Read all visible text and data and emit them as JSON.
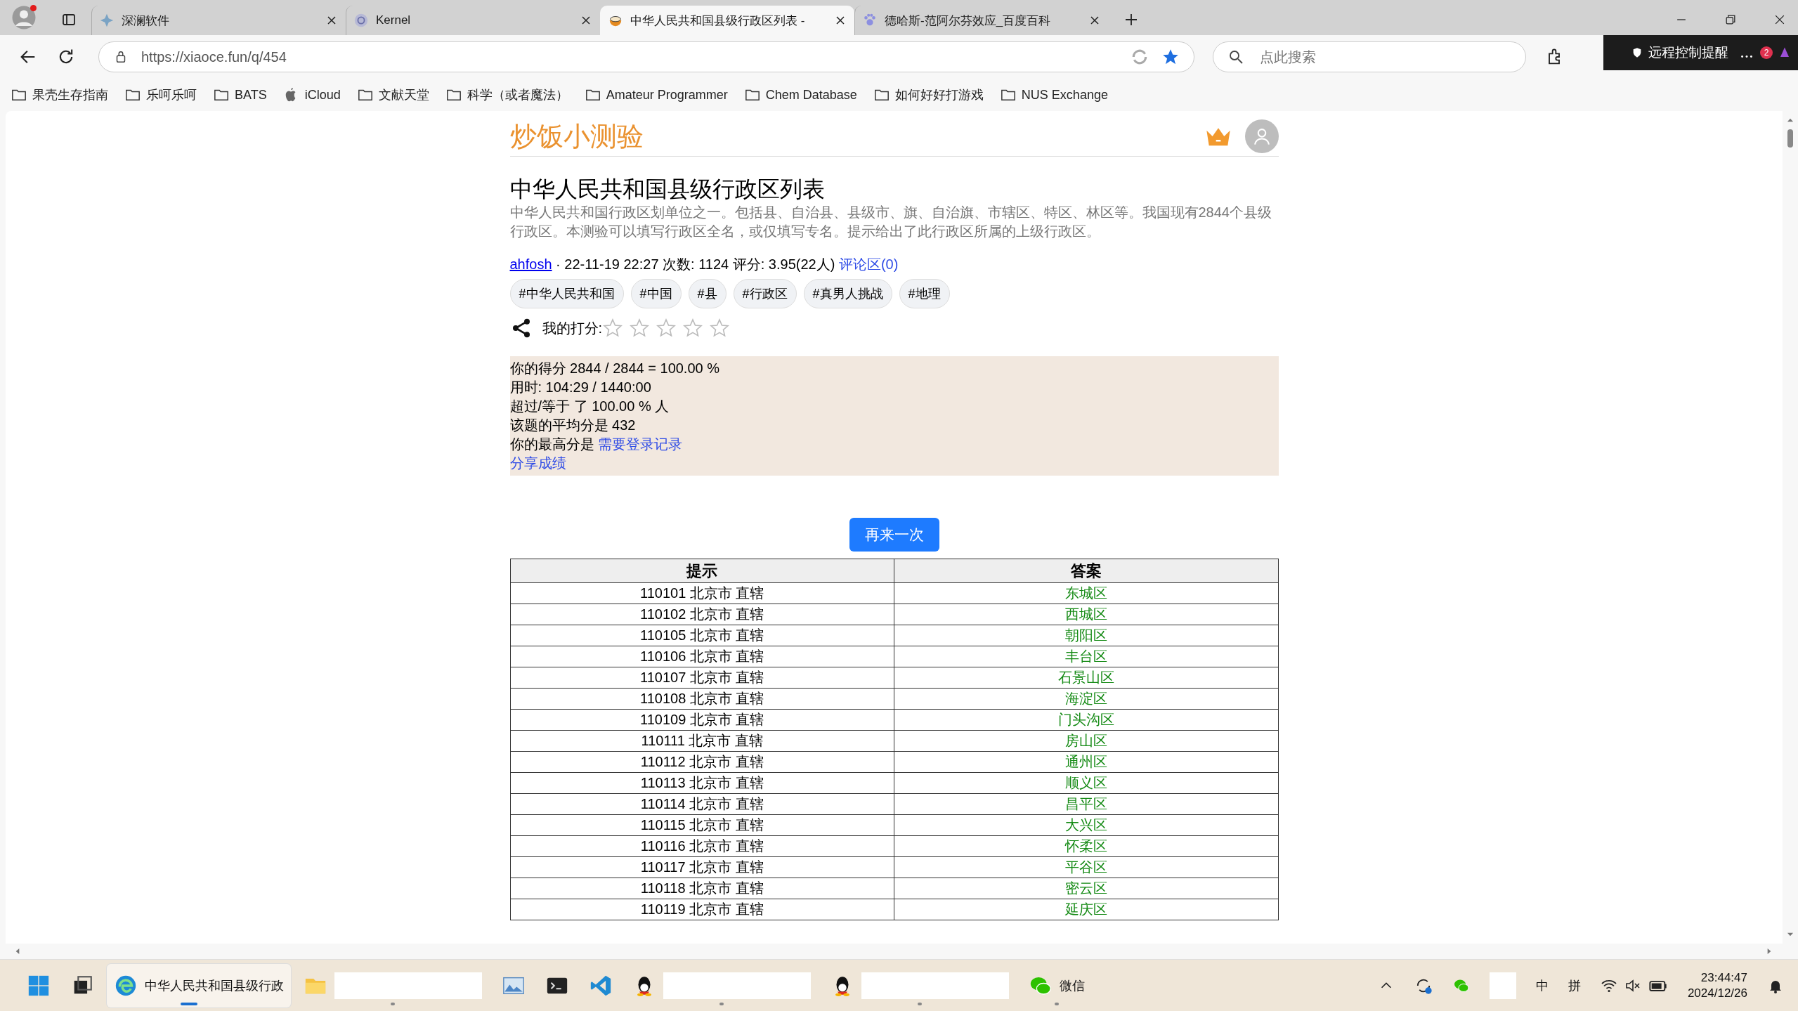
{
  "browser": {
    "tabs": [
      {
        "title": "深澜软件",
        "kind": "compass",
        "selected": false
      },
      {
        "title": "Kernel",
        "kind": "kernel",
        "selected": false
      },
      {
        "title": "中华人民共和国县级行政区列表 -",
        "kind": "bowl",
        "selected": true
      },
      {
        "title": "德哈斯-范阿尔芬效应_百度百科",
        "kind": "paw",
        "selected": false
      }
    ],
    "address": "https://xiaoce.fun/q/454",
    "search_placeholder": "点此搜索",
    "notification": {
      "text": "远程控制提醒",
      "badge": "2"
    },
    "bookmarks": [
      {
        "kind": "folder",
        "label": "果壳生存指南"
      },
      {
        "kind": "folder",
        "label": "乐呵乐呵"
      },
      {
        "kind": "folder",
        "label": "BATS"
      },
      {
        "kind": "apple",
        "label": "iCloud"
      },
      {
        "kind": "folder",
        "label": "文献天堂"
      },
      {
        "kind": "folder",
        "label": "科学（或者魔法）"
      },
      {
        "kind": "folder",
        "label": "Amateur Programmer"
      },
      {
        "kind": "folder",
        "label": "Chem Database"
      },
      {
        "kind": "folder",
        "label": "如何好好打游戏"
      },
      {
        "kind": "folder",
        "label": "NUS Exchange"
      }
    ]
  },
  "page": {
    "site_title": "炒饭小测验",
    "quiz_title": "中华人民共和国县级行政区列表",
    "description": "中华人民共和国行政区划单位之一。包括县、自治县、县级市、旗、自治旗、市辖区、特区、林区等。我国现有2844个县级行政区。本测验可以填写行政区全名，或仅填写专名。提示给出了此行政区所属的上级行政区。",
    "author": "ahfosh",
    "meta": "· 22-11-19 22:27 次数: 1124 评分: 3.95(22人)",
    "comments_link": "评论区(0)",
    "tags": [
      "#中华人民共和国",
      "#中国",
      "#县",
      "#行政区",
      "#真男人挑战",
      "#地理"
    ],
    "my_rating_label": "我的打分:",
    "stars": 0,
    "result_lines": [
      "你的得分 2844 / 2844 = 100.00 %",
      "用时: 104:29 / 1440:00",
      "超过/等于 了 100.00 % 人",
      "该题的平均分是 432"
    ],
    "best_score_label": "你的最高分是",
    "login_link": "需要登录记录",
    "share_link": "分享成绩",
    "retry_button": "再来一次",
    "table": {
      "columns": [
        "提示",
        "答案"
      ],
      "rows": [
        {
          "hint": "110101 北京市 直辖",
          "answer": "东城区"
        },
        {
          "hint": "110102 北京市 直辖",
          "answer": "西城区"
        },
        {
          "hint": "110105 北京市 直辖",
          "answer": "朝阳区"
        },
        {
          "hint": "110106 北京市 直辖",
          "answer": "丰台区"
        },
        {
          "hint": "110107 北京市 直辖",
          "answer": "石景山区"
        },
        {
          "hint": "110108 北京市 直辖",
          "answer": "海淀区"
        },
        {
          "hint": "110109 北京市 直辖",
          "answer": "门头沟区"
        },
        {
          "hint": "110111 北京市 直辖",
          "answer": "房山区"
        },
        {
          "hint": "110112 北京市 直辖",
          "answer": "通州区"
        },
        {
          "hint": "110113 北京市 直辖",
          "answer": "顺义区"
        },
        {
          "hint": "110114 北京市 直辖",
          "answer": "昌平区"
        },
        {
          "hint": "110115 北京市 直辖",
          "answer": "大兴区"
        },
        {
          "hint": "110116 北京市 直辖",
          "answer": "怀柔区"
        },
        {
          "hint": "110117 北京市 直辖",
          "answer": "平谷区"
        },
        {
          "hint": "110118 北京市 直辖",
          "answer": "密云区"
        },
        {
          "hint": "110119 北京市 直辖",
          "answer": "延庆区"
        }
      ]
    }
  },
  "taskbar": {
    "apps": [
      {
        "kind": "start",
        "running": false,
        "selected": false
      },
      {
        "kind": "taskview",
        "running": false,
        "selected": false
      },
      {
        "kind": "edge",
        "label": "中华人民共和国县级行政",
        "running": true,
        "selected": true
      },
      {
        "kind": "explorer",
        "blank": true,
        "running": true,
        "selected": false
      },
      {
        "kind": "photos",
        "running": false,
        "selected": false
      },
      {
        "kind": "terminal",
        "running": false,
        "selected": false
      },
      {
        "kind": "vscode",
        "running": false,
        "selected": false
      },
      {
        "kind": "qq",
        "blank": true,
        "running": true,
        "selected": false
      },
      {
        "kind": "qq",
        "blank": true,
        "running": true,
        "selected": false
      },
      {
        "kind": "wechat",
        "label": "微信",
        "running": true,
        "selected": false
      }
    ],
    "ime_mode": "中",
    "ime_name": "拼",
    "time": "23:44:47",
    "date": "2024/12/26"
  }
}
